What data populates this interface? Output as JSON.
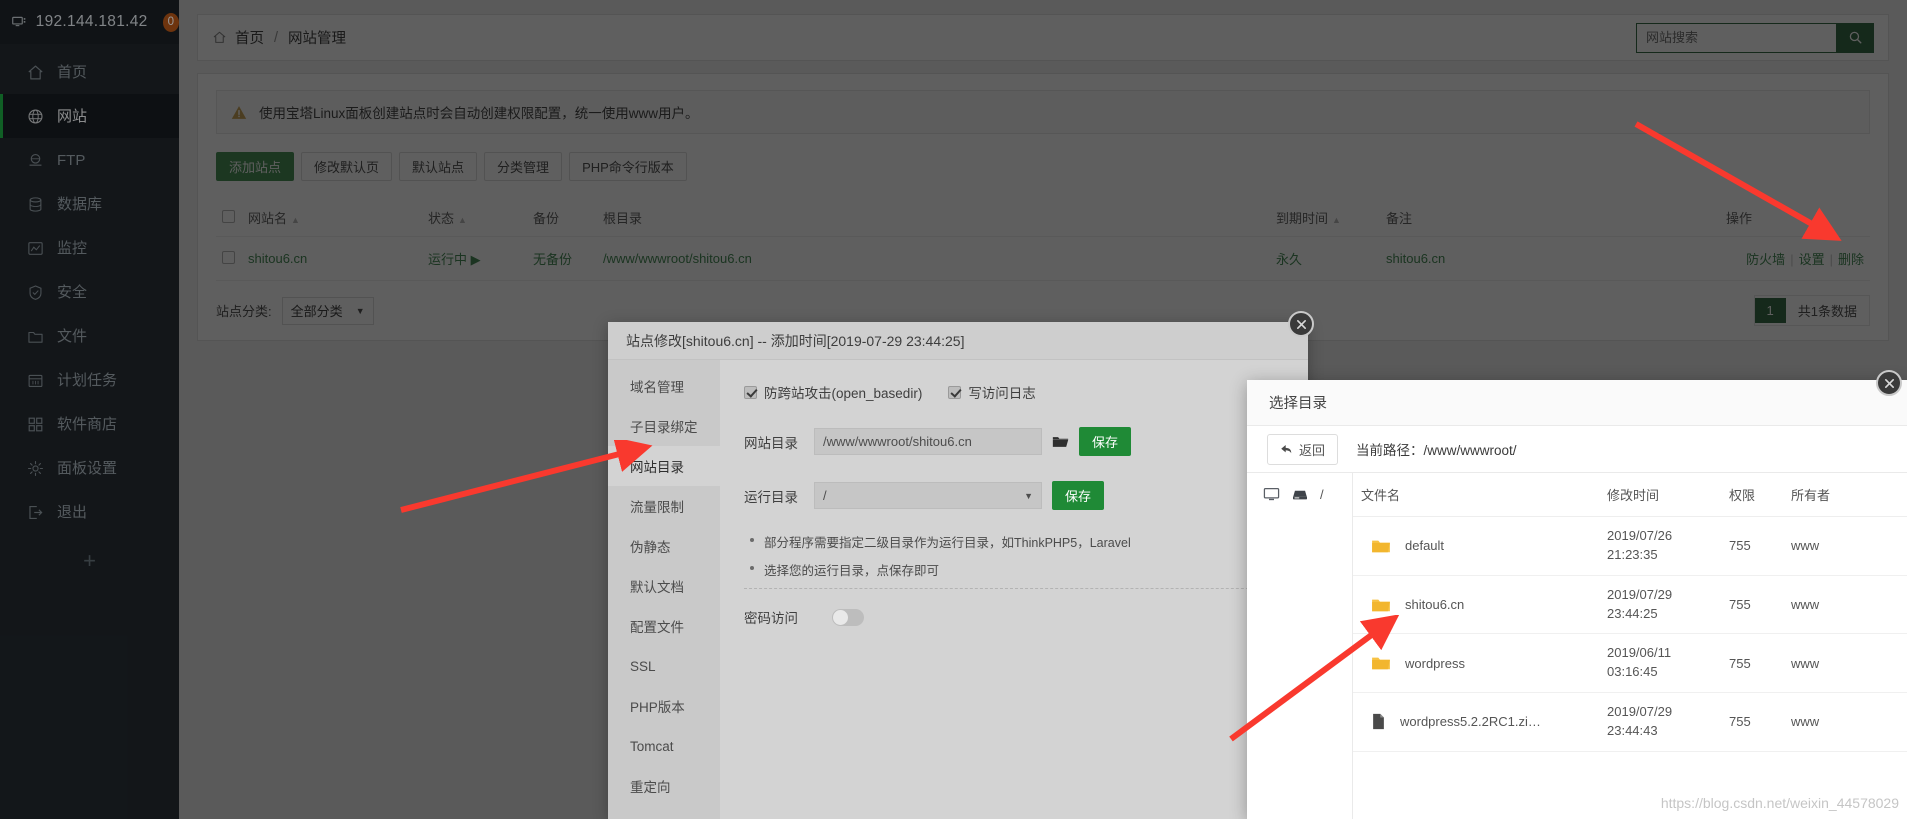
{
  "sidebar": {
    "host": "192.144.181.42",
    "badge": "0",
    "items": [
      {
        "label": "首页",
        "icon": "home-icon",
        "active": false
      },
      {
        "label": "网站",
        "icon": "globe-icon",
        "active": true
      },
      {
        "label": "FTP",
        "icon": "ftp-icon",
        "active": false
      },
      {
        "label": "数据库",
        "icon": "database-icon",
        "active": false
      },
      {
        "label": "监控",
        "icon": "monitor-icon",
        "active": false
      },
      {
        "label": "安全",
        "icon": "shield-icon",
        "active": false
      },
      {
        "label": "文件",
        "icon": "folder-icon",
        "active": false
      },
      {
        "label": "计划任务",
        "icon": "calendar-icon",
        "active": false
      },
      {
        "label": "软件商店",
        "icon": "grid-icon",
        "active": false
      },
      {
        "label": "面板设置",
        "icon": "gear-icon",
        "active": false
      },
      {
        "label": "退出",
        "icon": "logout-icon",
        "active": false
      }
    ],
    "add_label": "+"
  },
  "topbar": {
    "home_label": "首页",
    "separator": "/",
    "current_label": "网站管理",
    "search_placeholder": "网站搜索",
    "search_value": ""
  },
  "notice": {
    "text": "使用宝塔Linux面板创建站点时会自动创建权限配置，统一使用www用户。"
  },
  "toolbar": {
    "buttons": [
      {
        "label": "添加站点",
        "primary": true
      },
      {
        "label": "修改默认页",
        "primary": false
      },
      {
        "label": "默认站点",
        "primary": false
      },
      {
        "label": "分类管理",
        "primary": false
      },
      {
        "label": "PHP命令行版本",
        "primary": false
      }
    ]
  },
  "sites_table": {
    "headers": [
      "网站名",
      "状态",
      "备份",
      "根目录",
      "到期时间",
      "备注",
      "操作"
    ],
    "rows": [
      {
        "name": "shitou6.cn",
        "status": "运行中",
        "backup": "无备份",
        "root": "/www/wwwroot/shitou6.cn",
        "expire": "永久",
        "note": "shitou6.cn",
        "ops": [
          "防火墙",
          "设置",
          "删除"
        ]
      }
    ]
  },
  "footer": {
    "class_label": "站点分类:",
    "class_value": "全部分类",
    "page_current": "1",
    "total_text": "共1条数据"
  },
  "site_modal": {
    "title": "站点修改[shitou6.cn] -- 添加时间[2019-07-29 23:44:25]",
    "tabs": [
      {
        "label": "域名管理",
        "active": false
      },
      {
        "label": "子目录绑定",
        "active": false
      },
      {
        "label": "网站目录",
        "active": true
      },
      {
        "label": "流量限制",
        "active": false
      },
      {
        "label": "伪静态",
        "active": false
      },
      {
        "label": "默认文档",
        "active": false
      },
      {
        "label": "配置文件",
        "active": false
      },
      {
        "label": "SSL",
        "active": false
      },
      {
        "label": "PHP版本",
        "active": false
      },
      {
        "label": "Tomcat",
        "active": false
      },
      {
        "label": "重定向",
        "active": false
      }
    ],
    "checkboxes": [
      {
        "label": "防跨站攻击(open_basedir)",
        "checked": true
      },
      {
        "label": "写访问日志",
        "checked": true
      }
    ],
    "site_dir_label": "网站目录",
    "site_dir_value": "/www/wwwroot/shitou6.cn",
    "site_dir_save": "保存",
    "run_dir_label": "运行目录",
    "run_dir_value": "/",
    "run_dir_save": "保存",
    "tips": [
      "部分程序需要指定二级目录作为运行目录，如ThinkPHP5，Laravel",
      "选择您的运行目录，点保存即可"
    ],
    "password_label": "密码访问",
    "password_on": false
  },
  "file_picker": {
    "title": "选择目录",
    "back_label": "返回",
    "path_label": "当前路径：",
    "path_value": "/www/wwwroot/",
    "side_root": "/",
    "headers": [
      "文件名",
      "修改时间",
      "权限",
      "所有者"
    ],
    "rows": [
      {
        "name": "default",
        "type": "folder",
        "mtime": "2019/07/26\n21:23:35",
        "perm": "755",
        "owner": "www"
      },
      {
        "name": "shitou6.cn",
        "type": "folder",
        "mtime": "2019/07/29\n23:44:25",
        "perm": "755",
        "owner": "www"
      },
      {
        "name": "wordpress",
        "type": "folder",
        "mtime": "2019/06/11\n03:16:45",
        "perm": "755",
        "owner": "www"
      },
      {
        "name": "wordpress5.2.2RC1.zi…",
        "type": "file",
        "mtime": "2019/07/29\n23:44:43",
        "perm": "755",
        "owner": "www"
      }
    ]
  },
  "watermark": {
    "text": "https://blog.csdn.net/weixin_44578029"
  },
  "colors": {
    "accent_green": "#1f9e3c",
    "dark_green": "#1b7a34",
    "sidebar_bg": "#20262b",
    "badge_orange": "#b85818",
    "annotation_red": "#f9392e",
    "folder_yellow": "#f7c244"
  }
}
